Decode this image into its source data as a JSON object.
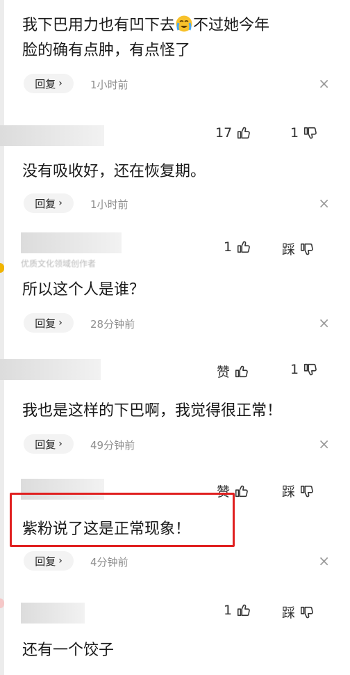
{
  "comments": [
    {
      "text_line1": "我下巴用力也有凹下去",
      "text_after_emoji": "不过她今年",
      "text_line2": "脸的确有点肿，有点怪了",
      "emoji": "crying-face-emoji",
      "reply_label": "回复",
      "time": "1小时前"
    },
    {
      "like_count": "17",
      "dislike_count": "1",
      "text": "没有吸收好，还在恢复期。",
      "reply_label": "回复",
      "time": "1小时前"
    },
    {
      "badge": "优质文化领域创作者",
      "like_count": "1",
      "dislike_label": "踩",
      "text": "所以这个人是谁？",
      "reply_label": "回复",
      "time": "28分钟前"
    },
    {
      "like_label": "赞",
      "dislike_count": "1",
      "text": "我也是这样的下巴啊，我觉得很正常！",
      "reply_label": "回复",
      "time": "49分钟前"
    },
    {
      "like_label": "赞",
      "dislike_label": "踩",
      "text": "紫粉说了这是正常现象！",
      "reply_label": "回复",
      "time": "4分钟前",
      "highlight_color": "#e02020"
    },
    {
      "like_count": "1",
      "dislike_label": "踩",
      "text": "还有一个饺子"
    }
  ],
  "icons": {
    "like": "thumbs-up-icon",
    "dislike": "thumbs-down-icon",
    "close": "close-icon",
    "chevron": "chevron-right-icon"
  },
  "colors": {
    "highlight": "#e02020",
    "muted_text": "#8e8e8e",
    "reply_bg": "#f3f3f3"
  }
}
